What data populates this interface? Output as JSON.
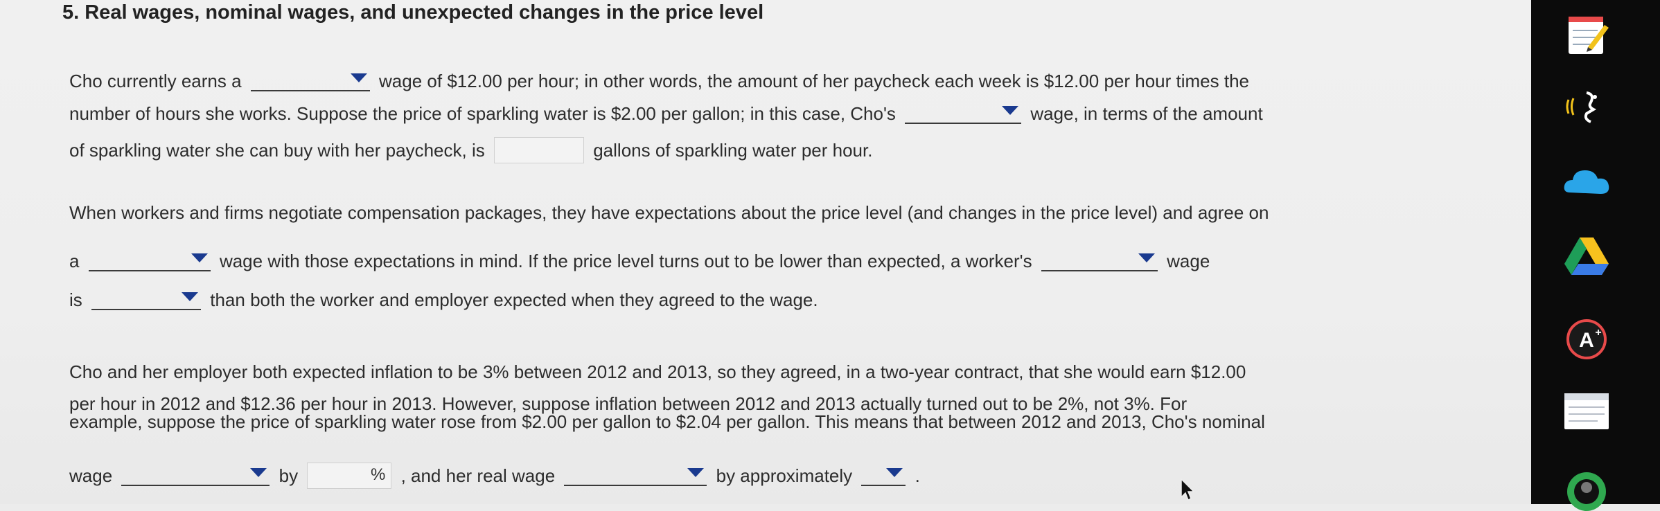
{
  "question": {
    "title": "5. Real wages, nominal wages, and unexpected changes in the price level",
    "p1": {
      "l1a": "Cho currently earns a",
      "l1b": "wage of $12.00 per hour; in other words, the amount of her paycheck each week is $12.00 per hour times the",
      "l2a": "number of hours she works. Suppose the price of sparkling water is $2.00 per gallon; in this case, Cho's",
      "l2b": "wage, in terms of the amount",
      "l3a": "of sparkling water she can buy with her paycheck, is",
      "l3b": "gallons of sparkling water per hour."
    },
    "p2": {
      "l1": "When workers and firms negotiate compensation packages, they have expectations about the price level (and changes in the price level) and agree on",
      "l2a": "a",
      "l2b": "wage with those expectations in mind. If the price level turns out to be lower than expected, a worker's",
      "l2c": "wage",
      "l3a": "is",
      "l3b": "than both the worker and employer expected when they agreed to the wage."
    },
    "p3": {
      "l1": "Cho and her employer both expected inflation to be 3% between 2012 and 2013, so they agreed, in a two-year contract, that she would earn $12.00",
      "l2": "per hour in 2012 and $12.36 per hour in 2013. However, suppose inflation between 2012 and 2013 actually turned out to be 2%, not 3%. For",
      "l3": "example, suppose the price of sparkling water rose from $2.00 per gallon to $2.04 per gallon. This means that between 2012 and 2013, Cho's nominal",
      "l4a": "wage",
      "l4b": "by",
      "l4c": ", and her real wage",
      "l4d": "by approximately",
      "l4e": "."
    },
    "units": {
      "percent": "%"
    },
    "inputs": {
      "gallons_value": "",
      "percent_value": ""
    }
  },
  "dropdowns": {
    "wage_type_1": "",
    "wage_type_2": "",
    "wage_type_3": "",
    "wage_type_4": "",
    "comparison": "",
    "nominal_change": "",
    "real_change": "",
    "approx_amount": ""
  },
  "colors": {
    "dropdown_arrow": "#1a3a8f",
    "page_bg": "#eeeeee",
    "sidebar_bg": "#0b0b0b"
  },
  "sidebar_icons": [
    "notes-icon",
    "read-aloud-icon",
    "cloud-icon",
    "drive-icon",
    "grade-plus-icon",
    "document-icon",
    "profile-icon"
  ]
}
